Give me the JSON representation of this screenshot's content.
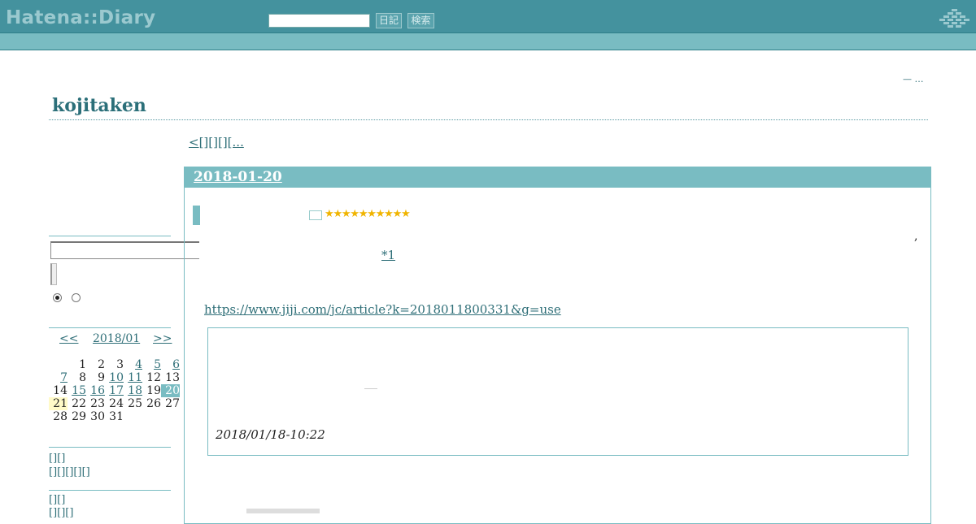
{
  "header": {
    "logo": "Hatena::Diary",
    "search_value": "",
    "diary_button": "日記",
    "search_button": "検索",
    "icon": "hatena-grid-icon"
  },
  "top_right_link": "— …",
  "blog": {
    "title": "kojitaken",
    "nav_link": "<[][][][..."
  },
  "sidebar": {
    "search_value": "",
    "radio_options": [
      "",
      ""
    ],
    "calendar": {
      "prev": "<<",
      "month": "2018/01",
      "next": ">>",
      "weeks": [
        [
          "",
          "1",
          "2",
          "3",
          "4",
          "5",
          "6"
        ],
        [
          "7",
          "8",
          "9",
          "10",
          "11",
          "12",
          "13"
        ],
        [
          "14",
          "15",
          "16",
          "17",
          "18",
          "19",
          "20"
        ],
        [
          "21",
          "22",
          "23",
          "24",
          "25",
          "26",
          "27"
        ],
        [
          "28",
          "29",
          "30",
          "31",
          "",
          "",
          ""
        ]
      ],
      "linked_days": [
        "4",
        "5",
        "6",
        "7",
        "10",
        "11",
        "15",
        "16",
        "17",
        "18"
      ],
      "selected_day": "20",
      "today": "21"
    },
    "links": [
      "[][]",
      "[][][][][]",
      "[][]",
      "[][][]"
    ]
  },
  "entry": {
    "date": "2018-01-20",
    "stars": "★★★★★★★★★★",
    "comma": ",",
    "footnote": "*1",
    "url": "https://www.jiji.com/jc/article?k=2018011800331&g=use",
    "quote_time": "2018/01/18-10:22"
  },
  "colors": {
    "header_bg": "#44929e",
    "accent": "#79bcc2",
    "link": "#2f6f78",
    "star": "#f0b400"
  }
}
